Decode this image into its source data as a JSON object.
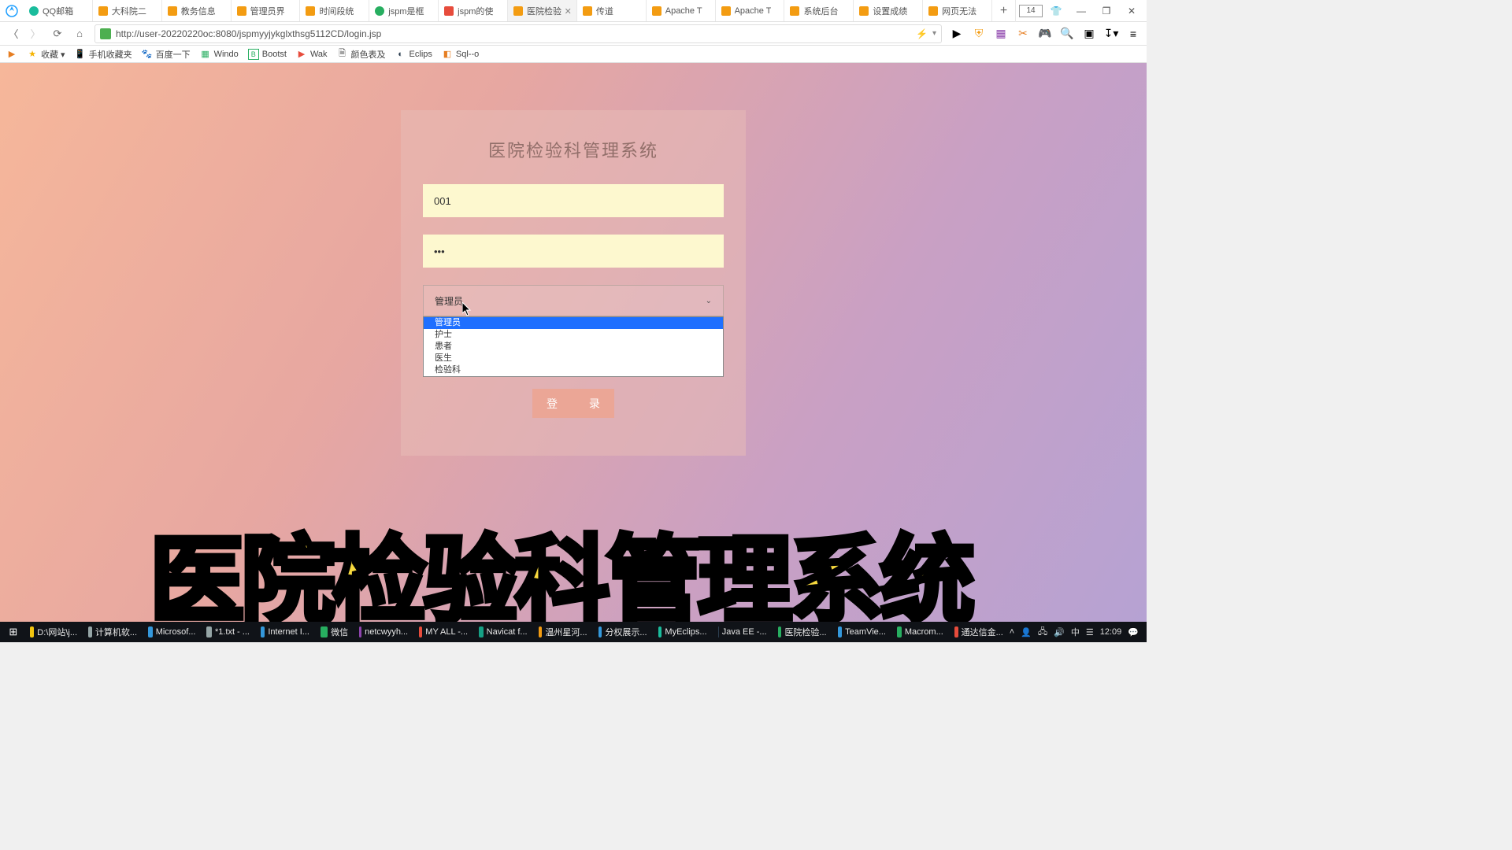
{
  "browser": {
    "tabs": [
      {
        "label": "QQ邮箱",
        "icon": "qq"
      },
      {
        "label": "大科院二",
        "icon": "page"
      },
      {
        "label": "教务信息",
        "icon": "page"
      },
      {
        "label": "管理员界",
        "icon": "page"
      },
      {
        "label": "时间段统",
        "icon": "page"
      },
      {
        "label": "jspm是框",
        "icon": "jspm"
      },
      {
        "label": "jspm的使",
        "icon": "csdn"
      },
      {
        "label": "医院检验科",
        "icon": "page",
        "active": true
      },
      {
        "label": "传道",
        "icon": "page"
      },
      {
        "label": "Apache T",
        "icon": "page"
      },
      {
        "label": "Apache T",
        "icon": "page"
      },
      {
        "label": "系统后台",
        "icon": "page"
      },
      {
        "label": "设置成绩",
        "icon": "page"
      },
      {
        "label": "网页无法",
        "icon": "page"
      }
    ],
    "tab_new": "+",
    "tab_count_badge": "14",
    "url": "http://user-20220220oc:8080/jspmyyjykglxthsg5112CD/login.jsp",
    "bookmarks": [
      {
        "label": "收藏 ▾",
        "icon": "star"
      },
      {
        "label": "手机收藏夹",
        "icon": "phone"
      },
      {
        "label": "百度一下",
        "icon": "baidu"
      },
      {
        "label": "Windo",
        "icon": "win"
      },
      {
        "label": "Bootst",
        "icon": "boot"
      },
      {
        "label": "Wak",
        "icon": "play"
      },
      {
        "label": "颜色表及",
        "icon": "doc"
      },
      {
        "label": "Eclips",
        "icon": "eclipse"
      },
      {
        "label": "Sql--o",
        "icon": "sql"
      }
    ]
  },
  "login": {
    "title": "医院检验科管理系统",
    "username": "001",
    "password": "•••",
    "role_selected": "管理员",
    "role_options": [
      "管理员",
      "护士",
      "患者",
      "医生",
      "检验科"
    ],
    "submit": "登 录"
  },
  "caption": "医院检验科管理系统",
  "taskbar": {
    "items": [
      {
        "label": "D:\\网站\\j...",
        "color": "c-yellow"
      },
      {
        "label": "计算机软...",
        "color": "c-grey"
      },
      {
        "label": "Microsof...",
        "color": "c-blue"
      },
      {
        "label": "*1.txt - ...",
        "color": "c-grey"
      },
      {
        "label": "Internet I...",
        "color": "c-blue"
      },
      {
        "label": "微信",
        "color": "c-green"
      },
      {
        "label": "netcwyyh...",
        "color": "c-purple"
      },
      {
        "label": "MY ALL -...",
        "color": "c-red"
      },
      {
        "label": "Navicat f...",
        "color": "c-teal"
      },
      {
        "label": "温州星河...",
        "color": "c-orange"
      },
      {
        "label": "分权展示...",
        "color": "c-blue"
      },
      {
        "label": "MyEclips...",
        "color": "c-cyan"
      },
      {
        "label": "Java EE -...",
        "color": "c-dkblue"
      },
      {
        "label": "医院检验...",
        "color": "c-green"
      },
      {
        "label": "TeamVie...",
        "color": "c-blue"
      },
      {
        "label": "Macrom...",
        "color": "c-green"
      },
      {
        "label": "通达信金...",
        "color": "c-red"
      }
    ],
    "tray": {
      "ime": "中",
      "clock": "12:09"
    }
  }
}
